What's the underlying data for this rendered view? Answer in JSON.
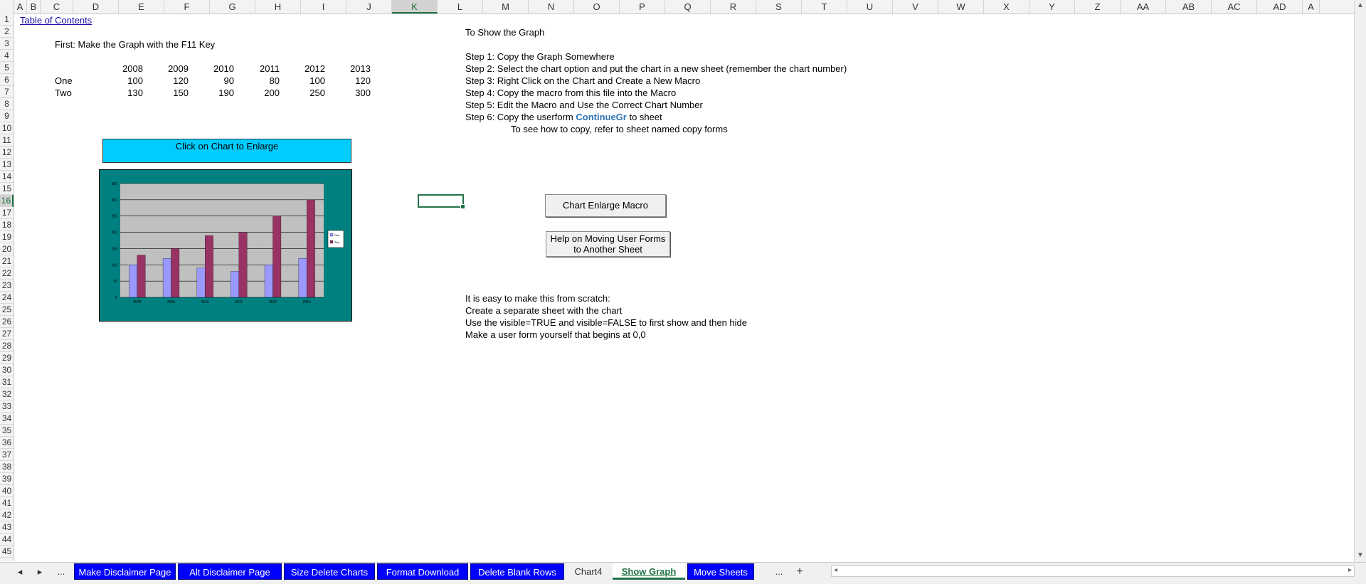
{
  "columns": [
    "A",
    "B",
    "C",
    "D",
    "E",
    "F",
    "G",
    "H",
    "I",
    "J",
    "K",
    "L",
    "M",
    "N",
    "O",
    "P",
    "Q",
    "R",
    "S",
    "T",
    "U",
    "V",
    "W",
    "X",
    "Y",
    "Z",
    "AA",
    "AB",
    "AC",
    "AD",
    "A"
  ],
  "selected_column": "K",
  "rows": [
    "1",
    "2",
    "3",
    "4",
    "5",
    "6",
    "7",
    "8",
    "9",
    "10",
    "11",
    "12",
    "13",
    "14",
    "15",
    "16",
    "17",
    "18",
    "19",
    "20",
    "21",
    "22",
    "23",
    "24",
    "25",
    "26",
    "27",
    "28",
    "29",
    "30",
    "31",
    "32",
    "33",
    "34",
    "35",
    "36",
    "37",
    "38",
    "39",
    "40",
    "41",
    "42",
    "43",
    "44",
    "45"
  ],
  "selected_row": "16",
  "sheet": {
    "toc_link": "Table of Contents",
    "first_step": "First: Make the Graph with the F11 Key",
    "years": [
      "2008",
      "2009",
      "2010",
      "2011",
      "2012",
      "2013"
    ],
    "row_one_label": "One",
    "row_one_values": [
      "100",
      "120",
      "90",
      "80",
      "100",
      "120"
    ],
    "row_two_label": "Two",
    "row_two_values": [
      "130",
      "150",
      "190",
      "200",
      "250",
      "300"
    ],
    "enlarge_label": "Click on Chart to Enlarge",
    "show_title": "To Show the Graph",
    "steps": [
      "Step 1: Copy the Graph Somewhere",
      "Step 2: Select the chart option and put the chart in a new sheet (remember the chart number)",
      "Step 3: Right Click on the Chart and Create a New Macro",
      "Step 4: Copy the macro from this file into the Macro",
      "Step 5: Edit the Macro and Use the Correct Chart Number"
    ],
    "step6_prefix": "Step 6: Copy the userform ",
    "step6_form": "ContinueGr",
    "step6_suffix": " to sheet",
    "copy_note": "To see how to copy, refer to sheet named copy forms",
    "macro_button": "Chart Enlarge Macro",
    "help_button_line1": "Help on Moving User Forms",
    "help_button_line2": "to Another Sheet",
    "scratch_lines": [
      "It is easy to make this from scratch:",
      "Create a separate sheet with the chart",
      "Use the visible=TRUE and visible=FALSE to first show and then hide",
      "Make a user form yourself that begins at 0,0"
    ]
  },
  "chart_data": {
    "type": "bar",
    "categories": [
      "2008",
      "2009",
      "2010",
      "2011",
      "2012",
      "2013"
    ],
    "series": [
      {
        "name": "One",
        "values": [
          100,
          120,
          90,
          80,
          100,
          120
        ],
        "color": "#9999ff"
      },
      {
        "name": "Two",
        "values": [
          130,
          150,
          190,
          200,
          250,
          300
        ],
        "color": "#993366"
      }
    ],
    "ylim": [
      0,
      350
    ],
    "yticks": [
      "0",
      "50",
      "100",
      "150",
      "200",
      "250",
      "300",
      "350"
    ],
    "grid": true,
    "legend": "right",
    "colors": {
      "chart_bg": "#008080",
      "plot_bg": "#c0c0c0"
    }
  },
  "tabs": {
    "nav_prev": "◂",
    "nav_next": "▸",
    "more_left": "...",
    "items": [
      {
        "label": "Make Disclaimer Page",
        "style": "blue"
      },
      {
        "label": "Alt Disclaimer Page",
        "style": "blue"
      },
      {
        "label": "Size Delete Charts",
        "style": "blue"
      },
      {
        "label": "Format Download",
        "style": "blue"
      },
      {
        "label": "Delete Blank Rows",
        "style": "blue"
      },
      {
        "label": "Chart4",
        "style": "plain"
      },
      {
        "label": "Show Graph",
        "style": "active"
      },
      {
        "label": "Move Sheets",
        "style": "blue"
      }
    ],
    "more_right": "...",
    "add_sheet": "+",
    "scroll_left": "◂",
    "scroll_right": "▸"
  },
  "colors": {
    "accent": "#217346",
    "tab_blue": "#0000ff",
    "enlarge_bg": "#00ccff"
  }
}
